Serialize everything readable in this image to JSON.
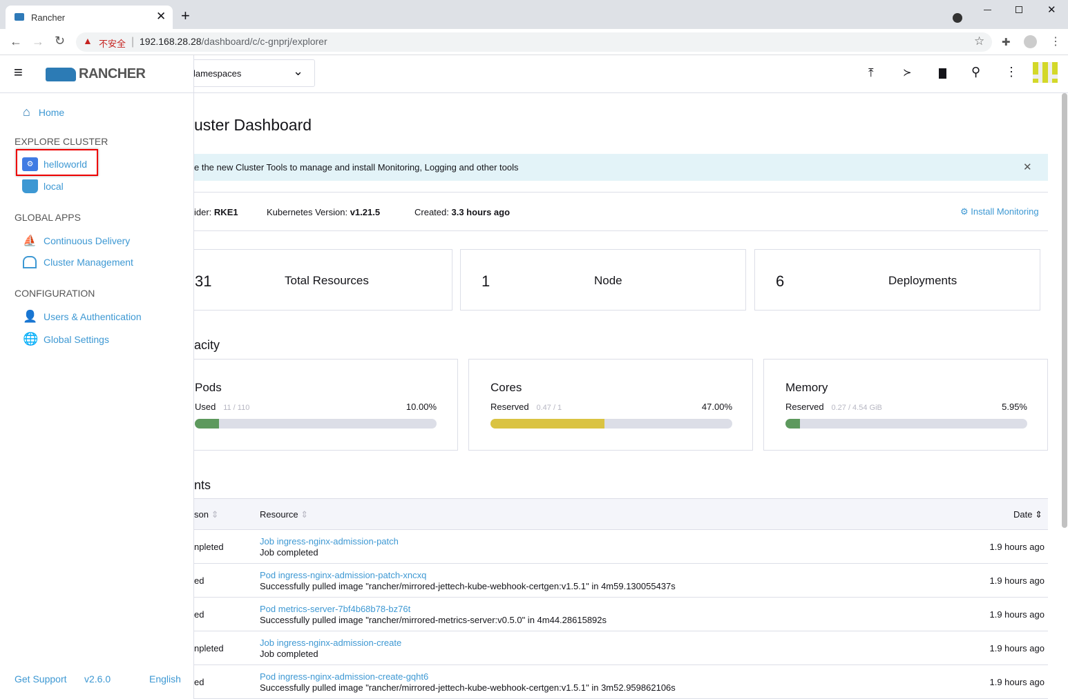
{
  "browser": {
    "tab_title": "Rancher",
    "security_label": "不安全",
    "url_host": "192.168.28.28",
    "url_path": "/dashboard/c/c-gnprj/explorer"
  },
  "header": {
    "brand": "RANCHER",
    "namespace_select": "lamespaces"
  },
  "sidebar": {
    "home": "Home",
    "sections": [
      {
        "title": "EXPLORE CLUSTER",
        "items": [
          {
            "label": "helloworld",
            "icon": "tractor-icon",
            "selected": true
          },
          {
            "label": "local",
            "icon": "longhorn-icon"
          }
        ]
      },
      {
        "title": "GLOBAL APPS",
        "items": [
          {
            "label": "Continuous Delivery",
            "icon": "sailboat-icon"
          },
          {
            "label": "Cluster Management",
            "icon": "barn-icon"
          }
        ]
      },
      {
        "title": "CONFIGURATION",
        "items": [
          {
            "label": "Users & Authentication",
            "icon": "user-icon"
          },
          {
            "label": "Global Settings",
            "icon": "globe-icon"
          }
        ]
      }
    ],
    "footer": {
      "support": "Get Support",
      "version": "v2.6.0",
      "language": "English"
    }
  },
  "main": {
    "title": "uster Dashboard",
    "banner": "e the new Cluster Tools to manage and install Monitoring, Logging and other tools",
    "meta": {
      "provider_label": "ider:",
      "provider": "RKE1",
      "k8s_label": "Kubernetes Version:",
      "k8s": "v1.21.5",
      "created_label": "Created:",
      "created": "3.3 hours ago",
      "install_monitoring": "Install Monitoring"
    },
    "counts": [
      {
        "value": "31",
        "label": "Total Resources"
      },
      {
        "value": "1",
        "label": "Node"
      },
      {
        "value": "6",
        "label": "Deployments"
      }
    ],
    "capacity_title": "acity",
    "capacity": [
      {
        "title": "Pods",
        "kind": "Used",
        "amount": "11 / 110",
        "percent": "10.00%",
        "fraction": 0.1,
        "color": "#5d995d"
      },
      {
        "title": "Cores",
        "kind": "Reserved",
        "amount": "0.47 / 1",
        "percent": "47.00%",
        "fraction": 0.47,
        "color": "#dac342"
      },
      {
        "title": "Memory",
        "kind": "Reserved",
        "amount": "0.27 / 4.54 GiB",
        "percent": "5.95%",
        "fraction": 0.0595,
        "color": "#5d995d"
      }
    ],
    "events_title": "nts",
    "columns": {
      "reason": "son",
      "resource": "Resource",
      "date": "Date"
    },
    "events": [
      {
        "reason": "npleted",
        "resource": "Job ingress-nginx-admission-patch",
        "message": "Job completed",
        "date": "1.9 hours ago"
      },
      {
        "reason": "ed",
        "resource": "Pod ingress-nginx-admission-patch-xncxq",
        "message": "Successfully pulled image \"rancher/mirrored-jettech-kube-webhook-certgen:v1.5.1\" in 4m59.130055437s",
        "date": "1.9 hours ago"
      },
      {
        "reason": "ed",
        "resource": "Pod metrics-server-7bf4b68b78-bz76t",
        "message": "Successfully pulled image \"rancher/mirrored-metrics-server:v0.5.0\" in 4m44.28615892s",
        "date": "1.9 hours ago"
      },
      {
        "reason": "npleted",
        "resource": "Job ingress-nginx-admission-create",
        "message": "Job completed",
        "date": "1.9 hours ago"
      },
      {
        "reason": "ed",
        "resource": "Pod ingress-nginx-admission-create-gqht6",
        "message": "Successfully pulled image \"rancher/mirrored-jettech-kube-webhook-certgen:v1.5.1\" in 3m52.959862106s",
        "date": "1.9 hours ago"
      }
    ]
  }
}
